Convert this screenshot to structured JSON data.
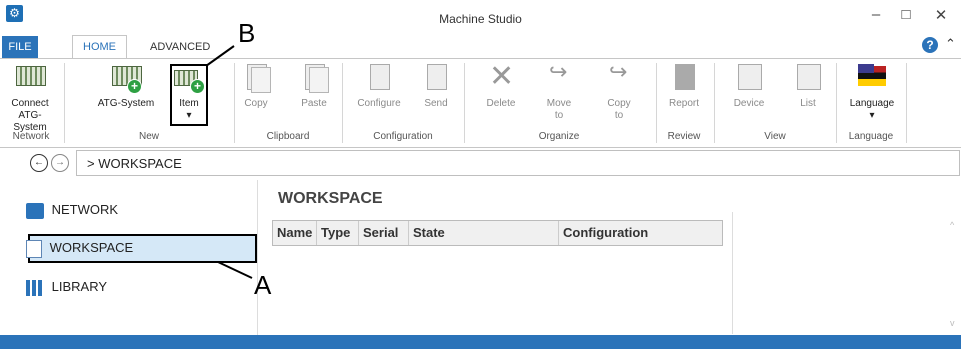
{
  "window": {
    "title": "Machine Studio",
    "minimize": "–",
    "maximize": "□",
    "close": "✕"
  },
  "tabs": {
    "file": "FILE",
    "home": "HOME",
    "advanced": "ADVANCED"
  },
  "ribbon": {
    "connect": "Connect ATG-System",
    "atg_system": "ATG-System",
    "item": "Item",
    "item_arrow": "▾",
    "copy": "Copy",
    "paste": "Paste",
    "configure": "Configure",
    "send": "Send",
    "delete": "Delete",
    "move_to": "Move to",
    "copy_to": "Copy to",
    "report": "Report",
    "device": "Device",
    "list": "List",
    "language": "Language",
    "language_arrow": "▾",
    "groups": {
      "network": "Network",
      "new": "New",
      "clipboard": "Clipboard",
      "configuration": "Configuration",
      "organize": "Organize",
      "review": "Review",
      "view": "View",
      "language": "Language"
    }
  },
  "address": {
    "path": "> WORKSPACE"
  },
  "sidebar": {
    "items": [
      {
        "label": "NETWORK"
      },
      {
        "label": "WORKSPACE"
      },
      {
        "label": "LIBRARY"
      }
    ]
  },
  "main": {
    "title": "WORKSPACE",
    "columns": [
      "Name",
      "Type",
      "Serial",
      "State",
      "Configuration"
    ]
  },
  "annotations": {
    "a": "A",
    "b": "B"
  }
}
